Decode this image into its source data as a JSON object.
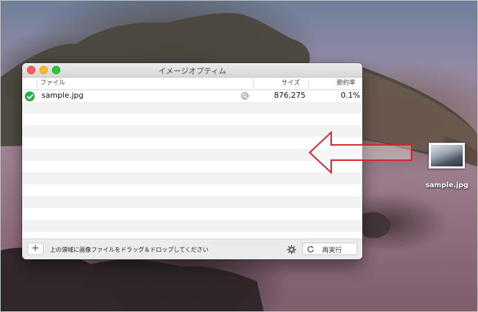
{
  "window": {
    "title": "イメージオプティム",
    "columns": {
      "file": "ファイル",
      "size": "サイズ",
      "savings": "節約率"
    },
    "files": [
      {
        "name": "sample.jpg",
        "size": "876,275",
        "savings": "0.1%",
        "status": "done",
        "status_color": "#2fb344"
      }
    ],
    "footer": {
      "add_label": "+",
      "hint": "上の領域に画像ファイルをドラッグ＆ドロップしてください",
      "rerun_label": "再実行"
    }
  },
  "desktop": {
    "file_label": "sample.jpg"
  },
  "annotation": {
    "arrow_color": "#d9202a",
    "direction": "left"
  }
}
